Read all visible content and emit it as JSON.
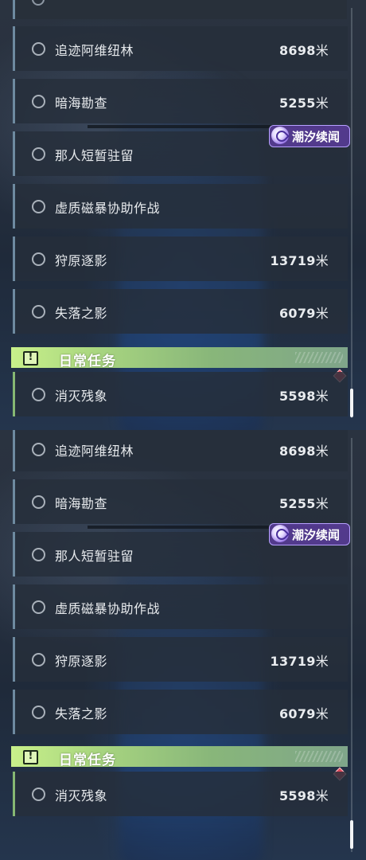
{
  "quests": [
    {
      "title": "追迹阿维纽林",
      "distance": "8698",
      "unit": "米"
    },
    {
      "title": "暗海勘查",
      "distance": "5255",
      "unit": "米"
    },
    {
      "title": "那人短暂驻留",
      "distance": "",
      "unit": ""
    },
    {
      "title": "虚质磁暴协助作战",
      "distance": "",
      "unit": ""
    },
    {
      "title": "狩原逐影",
      "distance": "13719",
      "unit": "米"
    },
    {
      "title": "失落之影",
      "distance": "6079",
      "unit": "米"
    }
  ],
  "badge": {
    "label": "潮汐续闻",
    "icon": "tidal-emblem-icon"
  },
  "daily": {
    "header": "日常任务",
    "icon": "exclamation-box-icon",
    "items": [
      {
        "title": "消灭残象",
        "distance": "5598",
        "unit": "米"
      }
    ]
  },
  "colors": {
    "quest_accent": "#6e8aa0",
    "daily_accent": "#86b873",
    "daily_header": "#c8f08a",
    "badge_bg": "#583c96",
    "marker_red": "#e04a5a"
  }
}
